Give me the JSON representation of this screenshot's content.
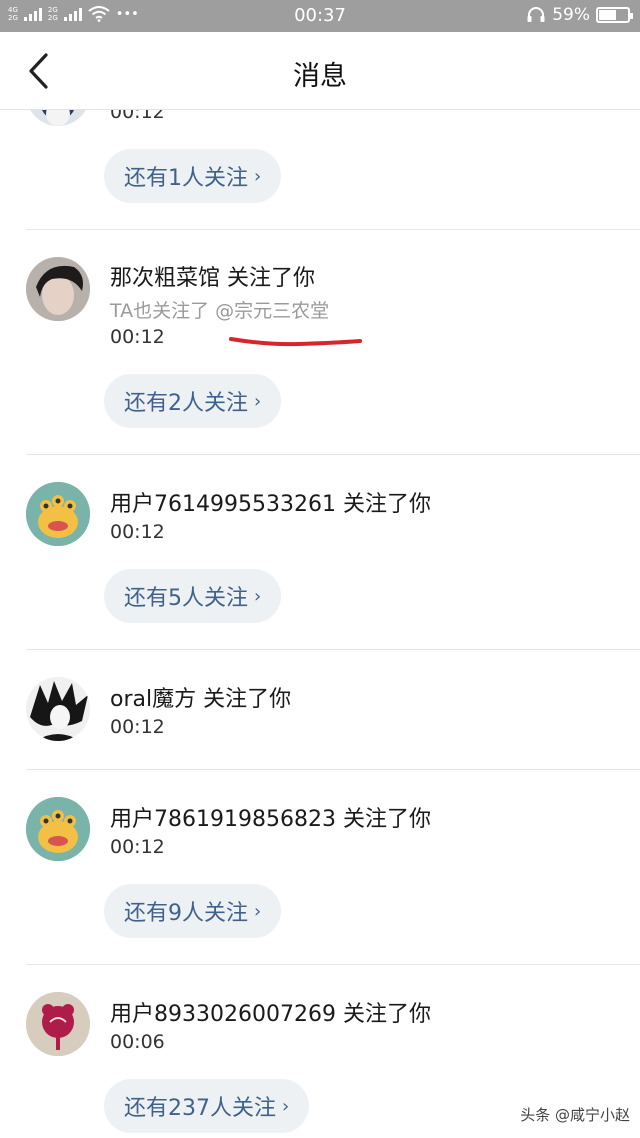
{
  "status_bar": {
    "network_top": "4G",
    "network_bottom": "2G",
    "network2_top": "2G",
    "network2_bottom": "2G",
    "more_dots": "•••",
    "time": "00:37",
    "battery_text": "59%",
    "battery_level": 0.59
  },
  "header": {
    "title": "消息"
  },
  "items": [
    {
      "title": "",
      "time": "00:12",
      "more": "还有1人关注"
    },
    {
      "title": "那次粗菜馆 关注了你",
      "subtitle": "TA也关注了 @宗元三农堂",
      "time": "00:12",
      "more": "还有2人关注"
    },
    {
      "title": "用户7614995533261 关注了你",
      "time": "00:12",
      "more": "还有5人关注"
    },
    {
      "title": "oral魔方 关注了你",
      "time": "00:12"
    },
    {
      "title": "用户7861919856823 关注了你",
      "time": "00:12",
      "more": "还有9人关注"
    },
    {
      "title": "用户8933026007269 关注了你",
      "time": "00:06",
      "more": "还有237人关注"
    }
  ],
  "icons": {
    "back": "chevron-left-icon",
    "more_chevron": "›"
  },
  "watermark": "头条 @咸宁小赵",
  "colors": {
    "status_bar_bg": "#9e9e9e",
    "button_bg": "#eef1f4",
    "button_text": "#40628a",
    "underline": "#d6262c"
  }
}
